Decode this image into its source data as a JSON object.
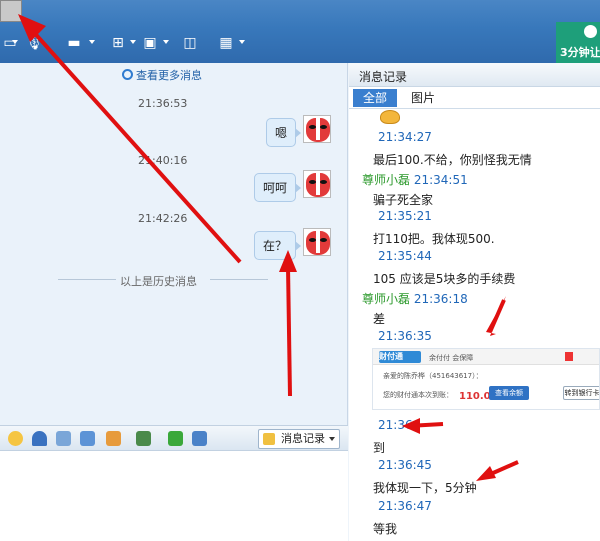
{
  "toolbar": {
    "icons": [
      "screen-share-icon",
      "microphone-icon",
      "folder-icon",
      "add-app-icon",
      "remote-desktop-icon",
      "screenshot-icon",
      "apps-grid-icon"
    ],
    "promo_label": "3分钟让"
  },
  "chat": {
    "more_messages": "查看更多消息",
    "messages": [
      {
        "time": "21:36:53",
        "text": "嗯"
      },
      {
        "time": "21:40:16",
        "text": "呵呵"
      },
      {
        "time": "21:42:26",
        "text": "在？"
      }
    ],
    "history_divider": "以上是历史消息"
  },
  "bottom_toolbar": {
    "history_button": "消息记录"
  },
  "history_panel": {
    "title": "消息记录",
    "tabs": [
      "全部",
      "图片"
    ],
    "entries": [
      {
        "time": "21:34:27"
      },
      {
        "msg": "最后100.不给，你别怪我无情"
      },
      {
        "sender": "尊师小磊",
        "time": "21:34:51"
      },
      {
        "msg": "骗子死全家"
      },
      {
        "time": "21:35:21"
      },
      {
        "msg": "打110把。我体现500."
      },
      {
        "time": "21:35:44"
      },
      {
        "msg": "105 应该是5块多的手续费"
      },
      {
        "sender": "尊师小磊",
        "time": "21:36:18"
      },
      {
        "msg": "差"
      },
      {
        "time": "21:36:35"
      },
      {
        "time": "21:36:"
      },
      {
        "msg": "到"
      },
      {
        "time": "21:36:45"
      },
      {
        "msg": "我体现一下，5分钟"
      },
      {
        "time": "21:36:47"
      },
      {
        "msg": "等我"
      }
    ],
    "screenshot": {
      "logo_text": "财付通",
      "header_text": "余付付 会保障",
      "account_line": "亲爱的陈乔桦（451643617）：",
      "amount_prefix": "您的财付通本次到账：",
      "amount": "110.00 元",
      "button_primary": "查看余额",
      "button_secondary": "转到银行卡"
    }
  },
  "colors": {
    "toolbar_blue": "#3878bb",
    "tab_active": "#3a7fcf",
    "time_blue": "#2067b8",
    "sender_green": "#2d9a2d",
    "arrow_red": "#e01010"
  }
}
